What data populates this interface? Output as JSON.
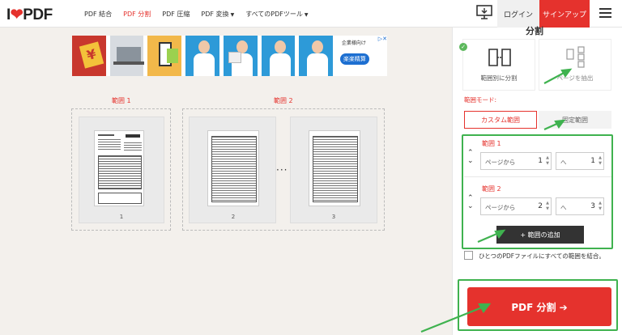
{
  "header": {
    "logo_prefix": "I",
    "logo_heart": "❤",
    "logo_suffix": "PDF",
    "nav": [
      "PDF 結合",
      "PDF 分割",
      "PDF 圧縮",
      "PDF 変換",
      "すべてのPDFツール"
    ],
    "login": "ログイン",
    "signup": "サインアップ"
  },
  "ad": {
    "line1": "企業様向け",
    "line2": "楽楽精算"
  },
  "ranges": {
    "label1": "範囲 1",
    "label2": "範囲 2",
    "pages": [
      "1",
      "2",
      "3"
    ],
    "dots": "···"
  },
  "panel": {
    "title": "分割",
    "tool1": "範囲別に分割",
    "tool2": "ページを抽出",
    "mode_label": "範囲モード:",
    "custom": "カスタム範囲",
    "fixed": "固定範囲",
    "rows": [
      {
        "label": "範囲 1",
        "from_prefix": "ページから",
        "from": "1",
        "to_prefix": "へ",
        "to": "1"
      },
      {
        "label": "範囲 2",
        "from_prefix": "ページから",
        "from": "2",
        "to_prefix": "へ",
        "to": "3"
      }
    ],
    "add": "+ 範囲の追加",
    "merge": "ひとつのPDFファイルにすべての範囲を結合。",
    "split": "PDF 分割 ➔"
  }
}
